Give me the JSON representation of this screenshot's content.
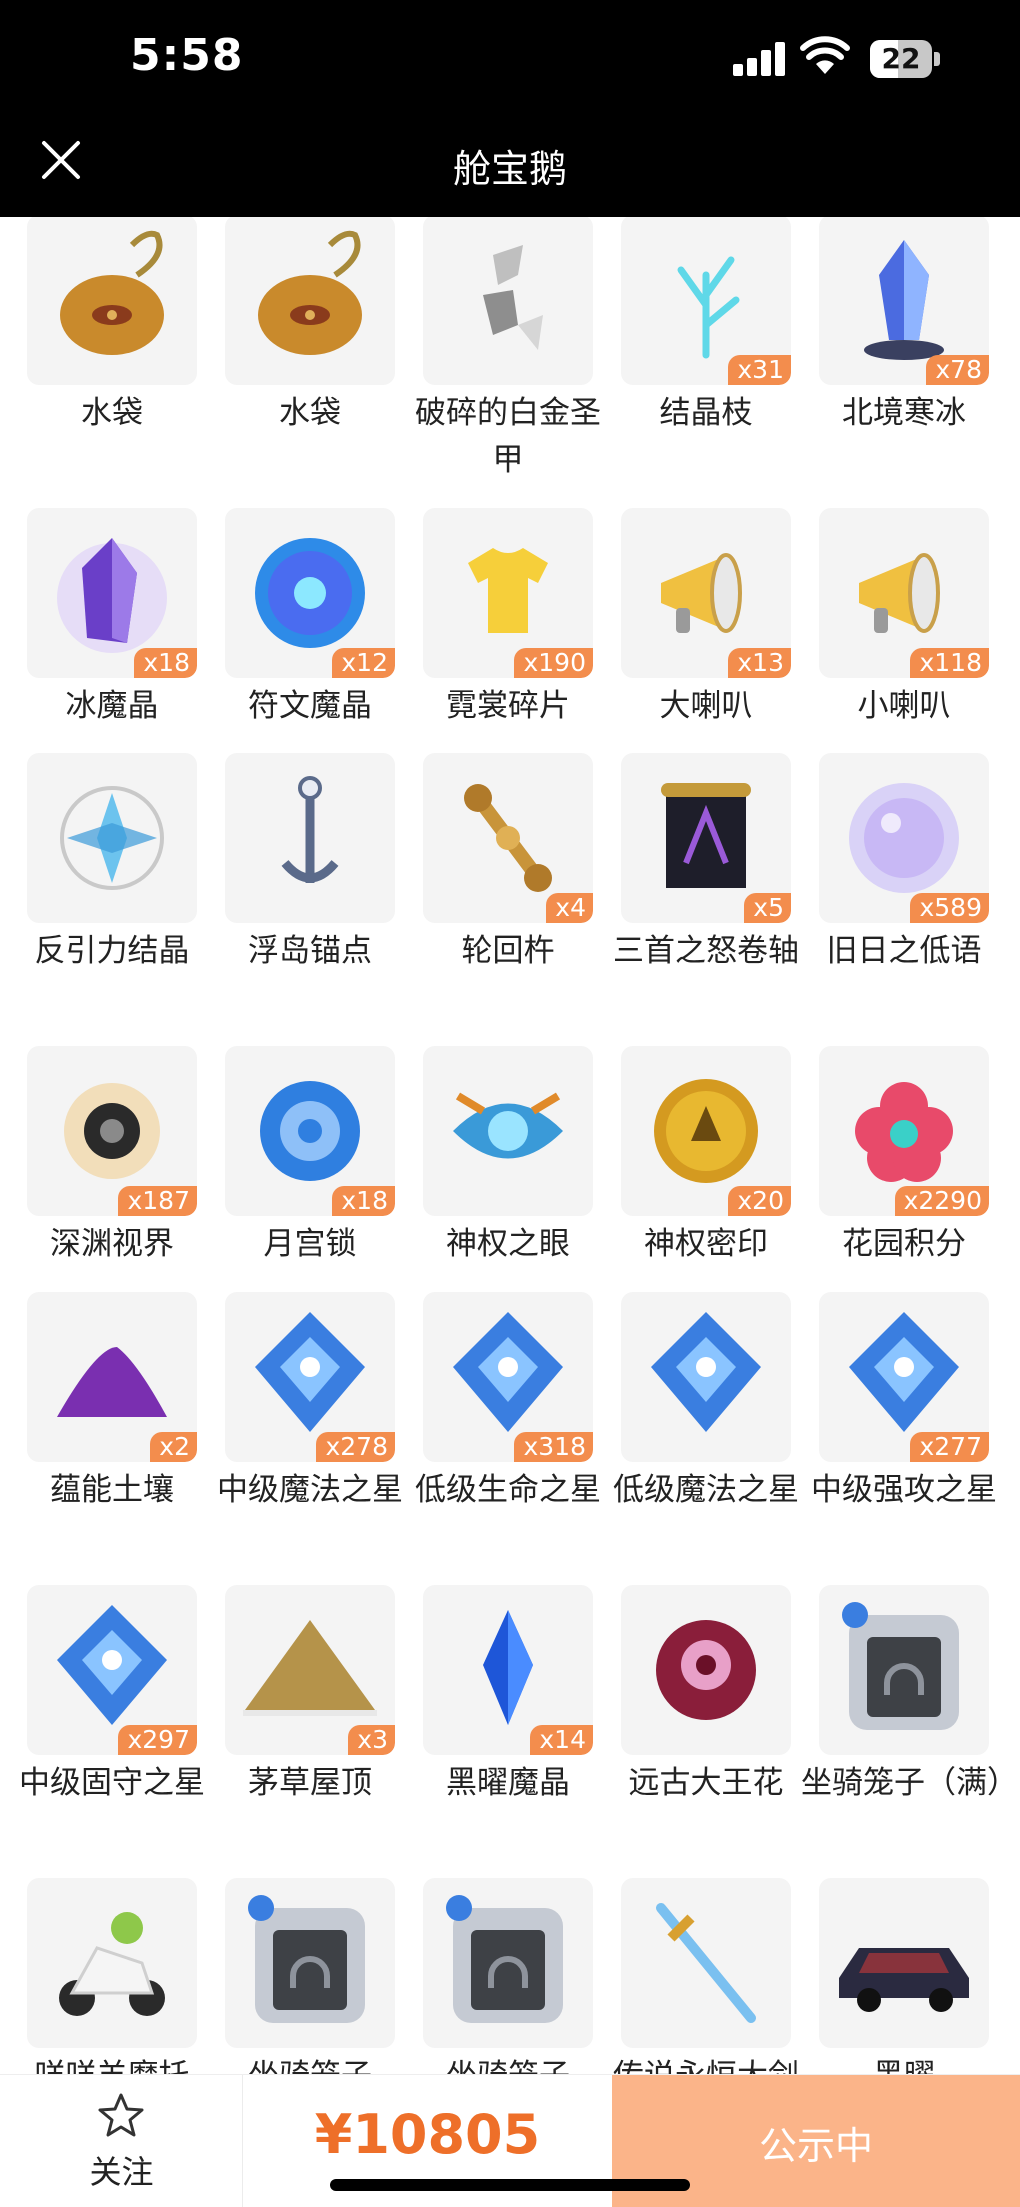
{
  "status": {
    "time": "5:58",
    "battery": "22"
  },
  "header": {
    "title": "舱宝鹅"
  },
  "items": [
    {
      "name": "水袋",
      "count": ""
    },
    {
      "name": "水袋",
      "count": ""
    },
    {
      "name": "破碎的白金圣甲",
      "count": ""
    },
    {
      "name": "结晶枝",
      "count": "x31"
    },
    {
      "name": "北境寒冰",
      "count": "x78"
    },
    {
      "name": "冰魔晶",
      "count": "x18"
    },
    {
      "name": "符文魔晶",
      "count": "x12"
    },
    {
      "name": "霓裳碎片",
      "count": "x190"
    },
    {
      "name": "大喇叭",
      "count": "x13"
    },
    {
      "name": "小喇叭",
      "count": "x118"
    },
    {
      "name": "反引力结晶",
      "count": ""
    },
    {
      "name": "浮岛锚点",
      "count": ""
    },
    {
      "name": "轮回杵",
      "count": "x4"
    },
    {
      "name": "三首之怒卷轴",
      "count": "x5"
    },
    {
      "name": "旧日之低语",
      "count": "x589"
    },
    {
      "name": "深渊视界",
      "count": "x187"
    },
    {
      "name": "月宫锁",
      "count": "x18"
    },
    {
      "name": "神权之眼",
      "count": ""
    },
    {
      "name": "神权密印",
      "count": "x20"
    },
    {
      "name": "花园积分",
      "count": "x2290"
    },
    {
      "name": "蕴能土壤",
      "count": "x2"
    },
    {
      "name": "中级魔法之星",
      "count": "x278"
    },
    {
      "name": "低级生命之星",
      "count": "x318"
    },
    {
      "name": "低级魔法之星",
      "count": ""
    },
    {
      "name": "中级强攻之星",
      "count": "x277"
    },
    {
      "name": "中级固守之星",
      "count": "x297"
    },
    {
      "name": "茅草屋顶",
      "count": "x3"
    },
    {
      "name": "黑曜魔晶",
      "count": "x14"
    },
    {
      "name": "远古大王花",
      "count": ""
    },
    {
      "name": "坐骑笼子（满）",
      "count": ""
    },
    {
      "name": "咩咩羊摩托",
      "count": ""
    },
    {
      "name": "坐骑笼子",
      "count": ""
    },
    {
      "name": "坐骑笼子",
      "count": ""
    },
    {
      "name": "传说永恒大剑",
      "count": ""
    },
    {
      "name": "黑曜",
      "count": ""
    }
  ],
  "icons": [
    "pouch-icon",
    "pouch-icon",
    "broken-armor-icon",
    "crystal-branch-icon",
    "ice-crystal-icon",
    "purple-crystal-icon",
    "rune-orb-icon",
    "tshirt-icon",
    "megaphone-icon",
    "megaphone-icon",
    "anti-gravity-icon",
    "anchor-icon",
    "vajra-icon",
    "scroll-icon",
    "bubble-icon",
    "abyss-eye-icon",
    "moon-lock-icon",
    "divine-eye-icon",
    "seal-coin-icon",
    "flower-icon",
    "soil-icon",
    "star-gem-icon",
    "star-gem-icon",
    "star-gem-icon",
    "star-gem-icon",
    "star-gem-icon",
    "thatch-roof-icon",
    "obsidian-icon",
    "rafflesia-icon",
    "cage-icon",
    "motorbike-icon",
    "cage-icon",
    "cage-icon",
    "sword-icon",
    "car-icon"
  ],
  "bottom": {
    "follow_label": "关注",
    "price": "¥10805",
    "status_button": "公示中"
  },
  "colors": {
    "accent": "#ee6f29",
    "badge": "#f38d4d",
    "button": "#fbb489"
  }
}
